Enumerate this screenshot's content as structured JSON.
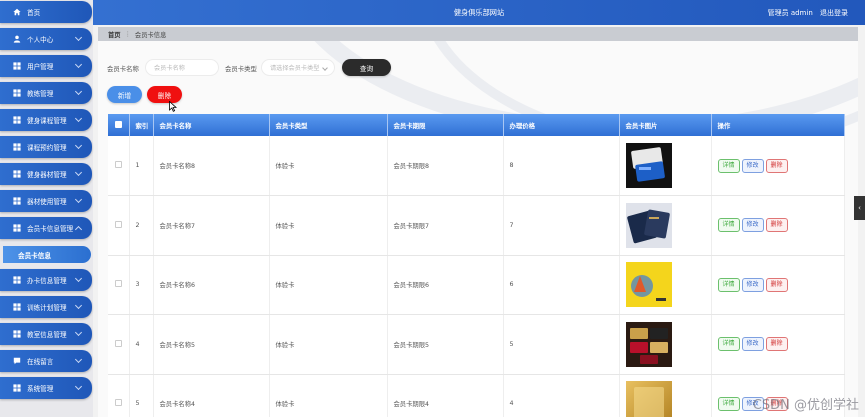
{
  "sidebar": {
    "items": [
      {
        "label": "首页",
        "icon": "home-icon"
      },
      {
        "label": "个人中心",
        "icon": "user-icon"
      },
      {
        "label": "用户管理",
        "icon": "grid-icon"
      },
      {
        "label": "教练管理",
        "icon": "grid-icon"
      },
      {
        "label": "健身课程管理",
        "icon": "grid-icon"
      },
      {
        "label": "课程预约管理",
        "icon": "grid-icon"
      },
      {
        "label": "健身器材管理",
        "icon": "grid-icon"
      },
      {
        "label": "器材使用管理",
        "icon": "grid-icon"
      },
      {
        "label": "会员卡信息管理",
        "icon": "grid-icon"
      },
      {
        "label": "办卡信息管理",
        "icon": "grid-icon"
      },
      {
        "label": "训练计划管理",
        "icon": "grid-icon"
      },
      {
        "label": "教室信息管理",
        "icon": "grid-icon"
      },
      {
        "label": "在线留言",
        "icon": "chat-icon"
      },
      {
        "label": "系统管理",
        "icon": "grid-icon"
      }
    ],
    "sub_item": "会员卡信息"
  },
  "header": {
    "title": "健身俱乐部网站",
    "admin_label": "管理员 admin",
    "logout_label": "退出登录"
  },
  "breadcrumb": {
    "home": "首页",
    "current": "会员卡信息"
  },
  "search": {
    "name_label": "会员卡名称",
    "name_placeholder": "会员卡名称",
    "type_label": "会员卡类型",
    "type_placeholder": "请选择会员卡类型",
    "query_label": "查询"
  },
  "actions": {
    "add_label": "新增",
    "delete_label": "删除"
  },
  "table": {
    "headers": [
      "索引",
      "会员卡名称",
      "会员卡类型",
      "会员卡期限",
      "办理价格",
      "会员卡图片",
      "操作"
    ],
    "op_labels": {
      "detail": "详情",
      "edit": "修改",
      "delete": "删除"
    },
    "rows": [
      {
        "index": "1",
        "name": "会员卡名称8",
        "type": "体验卡",
        "period": "会员卡期限8",
        "price": "8"
      },
      {
        "index": "2",
        "name": "会员卡名称7",
        "type": "体验卡",
        "period": "会员卡期限7",
        "price": "7"
      },
      {
        "index": "3",
        "name": "会员卡名称6",
        "type": "体验卡",
        "period": "会员卡期限6",
        "price": "6"
      },
      {
        "index": "4",
        "name": "会员卡名称5",
        "type": "体验卡",
        "period": "会员卡期限5",
        "price": "5"
      },
      {
        "index": "5",
        "name": "会员卡名称4",
        "type": "体验卡",
        "period": "会员卡期限4",
        "price": "4"
      }
    ]
  },
  "watermark": "CSDN @优创学社",
  "colors": {
    "primary": "#2f6ecf",
    "danger": "#f01010",
    "dark_button": "#2b2b2b"
  }
}
